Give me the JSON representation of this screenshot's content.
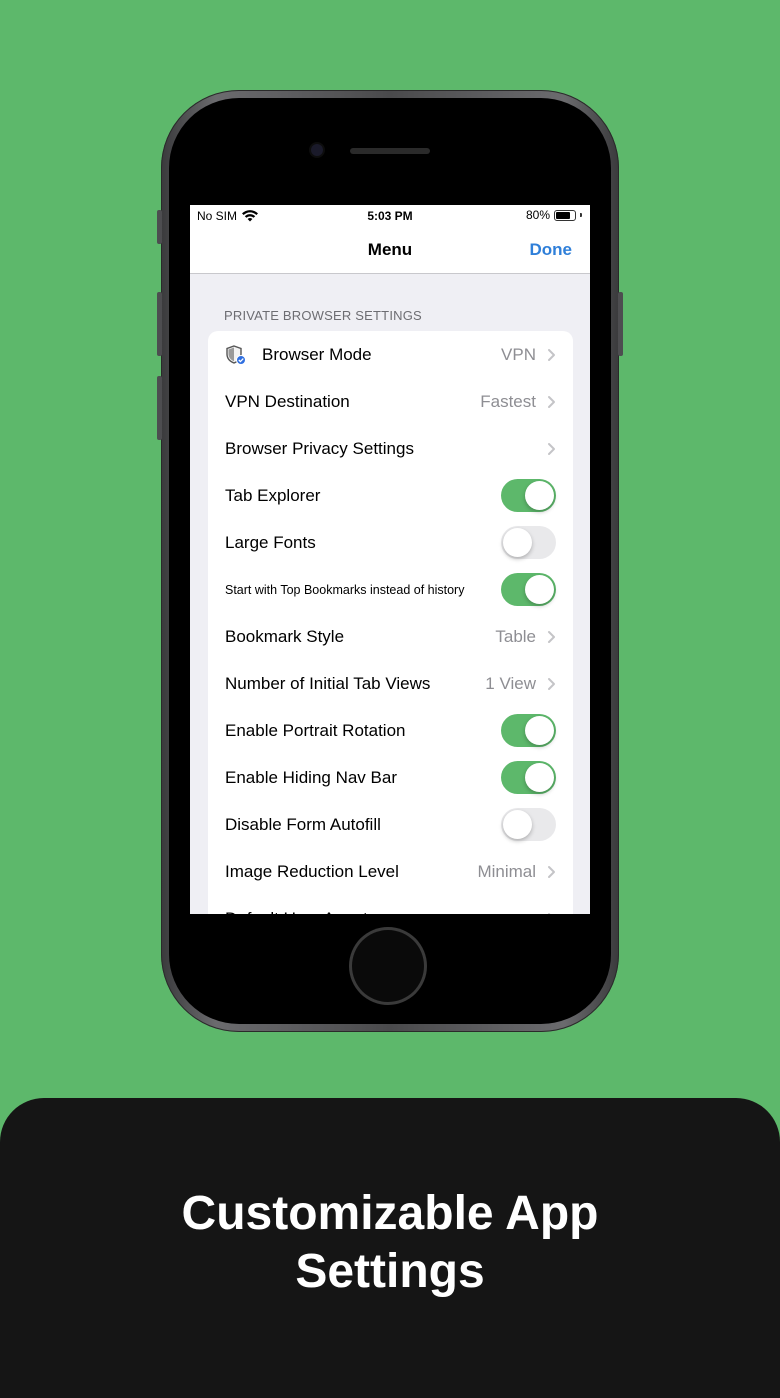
{
  "status_bar": {
    "carrier": "No SIM",
    "time": "5:03 PM",
    "battery": "80%",
    "battery_level": 0.8
  },
  "nav": {
    "title": "Menu",
    "done_label": "Done"
  },
  "section_header": "PRIVATE BROWSER SETTINGS",
  "rows": [
    {
      "label": "Browser Mode",
      "value": "VPN",
      "icon": "shield-icon"
    },
    {
      "label": "VPN Destination",
      "value": "Fastest"
    },
    {
      "label": "Browser Privacy Settings",
      "value": ""
    },
    {
      "label": "Tab Explorer",
      "toggle": true
    },
    {
      "label": "Large Fonts",
      "toggle": false
    },
    {
      "label": "Start with Top Bookmarks instead of history",
      "toggle": true
    },
    {
      "label": "Bookmark Style",
      "value": "Table"
    },
    {
      "label": "Number of Initial Tab Views",
      "value": "1 View"
    },
    {
      "label": "Enable Portrait Rotation",
      "toggle": true
    },
    {
      "label": "Enable Hiding Nav Bar",
      "toggle": true
    },
    {
      "label": "Disable Form Autofill",
      "toggle": false
    },
    {
      "label": "Image Reduction Level",
      "value": "Minimal"
    },
    {
      "label": "Default User Agent",
      "value": ""
    }
  ],
  "colors": {
    "background": "#5db86b",
    "toggle_on": "#5db86b",
    "link": "#2f7fd9",
    "panel": "#151515"
  },
  "caption": {
    "line1": "Customizable App",
    "line2": "Settings"
  }
}
